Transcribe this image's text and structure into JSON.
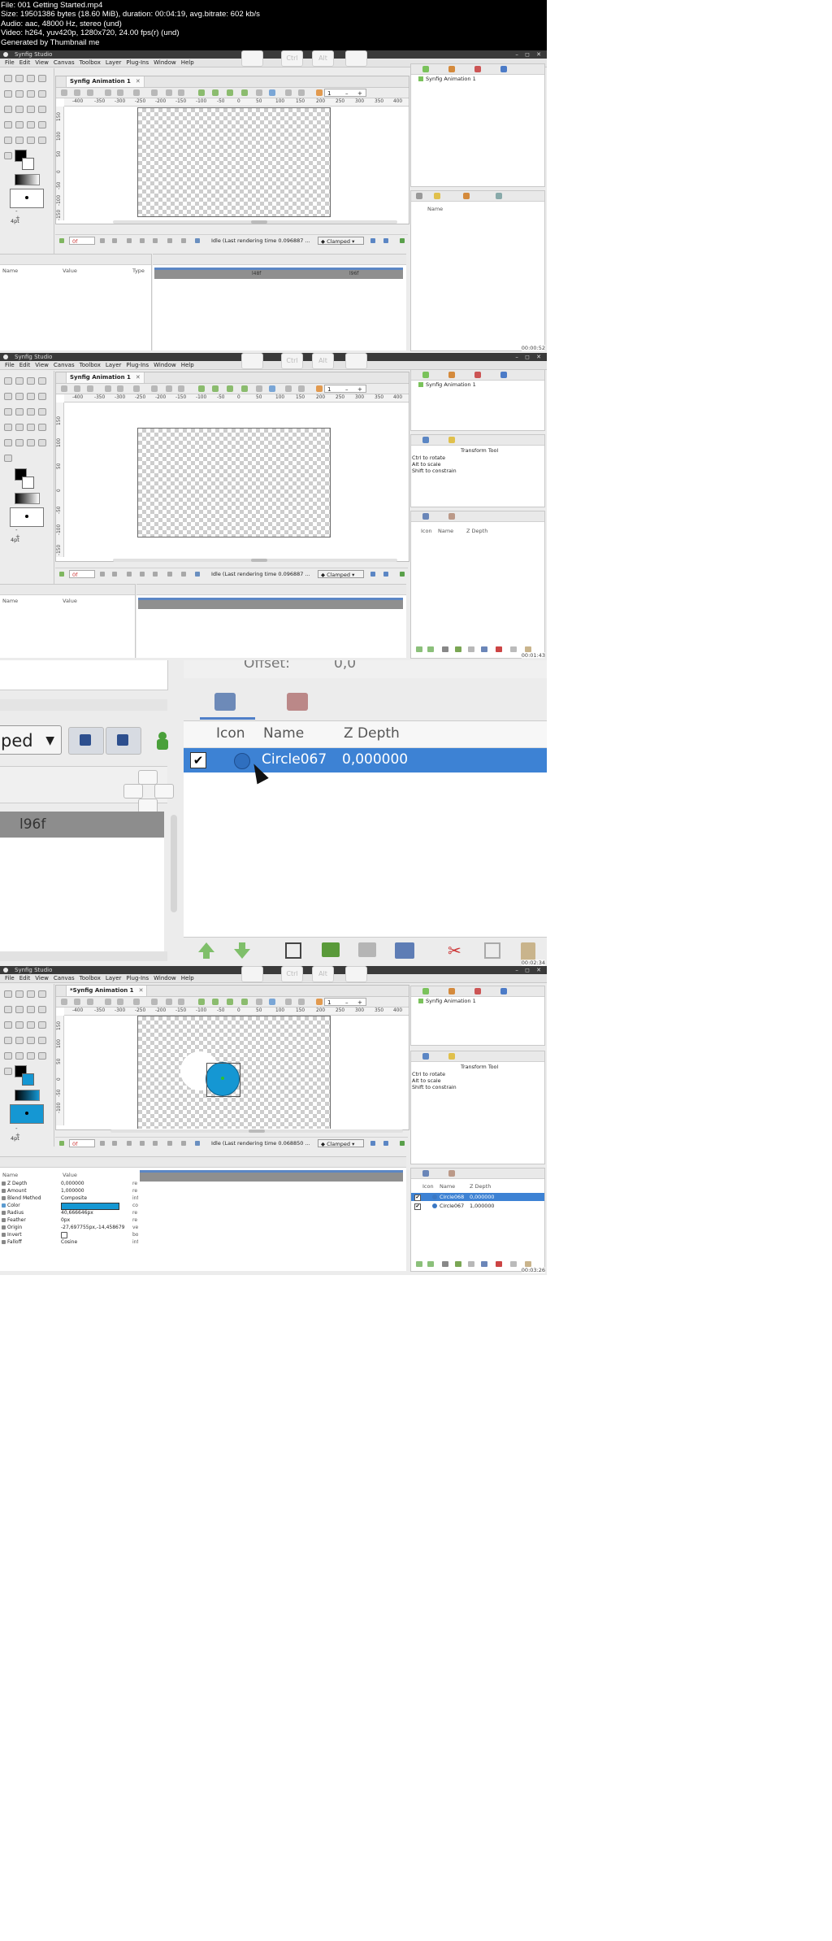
{
  "header": {
    "lines": [
      "File: 001 Getting Started.mp4",
      "Size: 19501386 bytes (18.60 MiB), duration: 00:04:19, avg.bitrate: 602 kb/s",
      "Audio: aac, 48000 Hz, stereo (und)",
      "Video: h264, yuv420p, 1280x720, 24.00 fps(r) (und)",
      "Generated by Thumbnail me"
    ]
  },
  "app": {
    "title": "Synfig Studio",
    "menu": [
      "File",
      "Edit",
      "View",
      "Canvas",
      "Toolbox",
      "Layer",
      "Plug-Ins",
      "Window",
      "Help"
    ],
    "keys": [
      "Ctrl",
      "Alt"
    ],
    "brush_size": "4pt",
    "plus_minus": "-  +",
    "spin_value": "1",
    "ruler_h": [
      "-400",
      "-350",
      "-300",
      "-250",
      "-200",
      "-150",
      "-100",
      "-50",
      "0",
      "50",
      "100",
      "150",
      "200",
      "250",
      "300",
      "350",
      "400"
    ],
    "ruler_v": [
      "150",
      "100",
      "50",
      "0",
      "-50",
      "-100",
      "-150"
    ],
    "frame": "0f",
    "interpolation": "Clamped",
    "params_cols": {
      "name": "Name",
      "value": "Value",
      "type": "Type"
    },
    "timebar_labels": [
      "l48f",
      "l96f"
    ],
    "canvas_item": "Synfig Animation 1",
    "library_col": "Name",
    "layers_cols": {
      "icon": "Icon",
      "name": "Name",
      "zdepth": "Z Depth"
    },
    "tool_title": "Transform Tool",
    "tool_hints": [
      "Ctrl to rotate",
      "Alt to scale",
      "Shift to constrain"
    ]
  },
  "frames": [
    {
      "tab": "Synfig Animation 1",
      "status": "Idle (Last rendering time 0.096887 ...",
      "timestamp": "00:00:52"
    },
    {
      "tab": "Synfig Animation 1",
      "status": "Idle (Last rendering time 0.096887 ...",
      "timestamp": "00:01:43"
    },
    {
      "timestamp": "00:02:34"
    },
    {
      "tab": "*Synfig Animation 1",
      "status": "Idle (Last rendering time 0.068850 ...",
      "timestamp": "00:03:26"
    }
  ],
  "zoom": {
    "offset_label": "Offset:",
    "offset_value": "0,0",
    "dropdown_partial": "ped",
    "timebar_label": "l96f",
    "layer": {
      "name": "Circle067",
      "zdepth": "0,000000"
    }
  },
  "frame4_params": [
    {
      "name": "Z Depth",
      "value": "0,000000",
      "type": "re"
    },
    {
      "name": "Amount",
      "value": "1,000000",
      "type": "re"
    },
    {
      "name": "Blend Method",
      "value": "Composite",
      "type": "int"
    },
    {
      "name": "Color",
      "value": "",
      "type": "co"
    },
    {
      "name": "Radius",
      "value": "40,666646px",
      "type": "re"
    },
    {
      "name": "Feather",
      "value": "0px",
      "type": "re"
    },
    {
      "name": "Origin",
      "value": "-27,697755px,-14,458679",
      "type": "ve"
    },
    {
      "name": "Invert",
      "value": "",
      "type": "bo"
    },
    {
      "name": "Falloff",
      "value": "Cosine",
      "type": "int"
    }
  ],
  "frame4_layers": [
    {
      "name": "Circle068",
      "zdepth": "0,000000",
      "selected": true
    },
    {
      "name": "Circle067",
      "zdepth": "1,000000",
      "selected": false
    }
  ],
  "colors": {
    "accent": "#3d82d4",
    "circle_fill": "#1597d3",
    "highlight": "#5b86c4"
  }
}
